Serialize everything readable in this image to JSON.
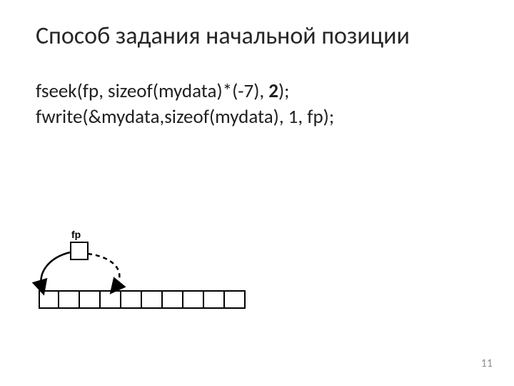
{
  "title": "Cпособ задания начальной позиции",
  "code": {
    "line1_a": "fseek(fp, sizeof(mydata)*(-7), ",
    "line1_b": "2",
    "line1_c": ");",
    "line2": "fwrite(&mydata,sizeof(mydata), 1, fp);"
  },
  "diagram": {
    "fp_label": "fp",
    "cell_count": 10
  },
  "page_number": "11"
}
